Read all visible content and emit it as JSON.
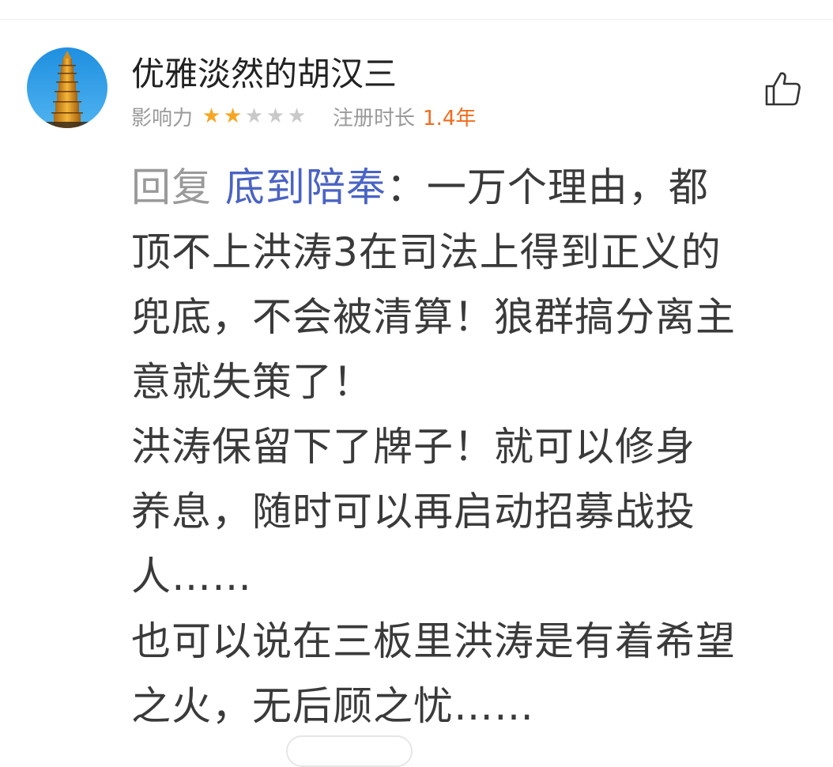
{
  "user": {
    "name": "优雅淡然的胡汉三",
    "influence_label": "影响力",
    "influence_stars": {
      "filled": 2,
      "total": 5
    },
    "registration_label": "注册时长",
    "registration_value": "1.4年"
  },
  "actions": {
    "like_icon": "thumbs-up-icon"
  },
  "comment": {
    "reply_prefix": "回复",
    "reply_target": "底到陪奉",
    "lines": [
      "：一万个理由，都",
      "顶不上洪涛3在司法上得到正义的",
      "兜底，不会被清算！狼群搞分离主",
      "意就失策了！",
      "洪涛保留下了牌子！就可以修身",
      "养息，随时可以再启动招募战投",
      "人……",
      "也可以说在三板里洪涛是有着希望",
      "之火，无后顾之忧……"
    ]
  },
  "colors": {
    "username": "#222222",
    "meta": "#9a9a9a",
    "star_on": "#f5a623",
    "star_off": "#c9c9c9",
    "registration_value": "#f26b1d",
    "reply_target": "#4a63c4",
    "body_text": "#3a3a3a"
  }
}
